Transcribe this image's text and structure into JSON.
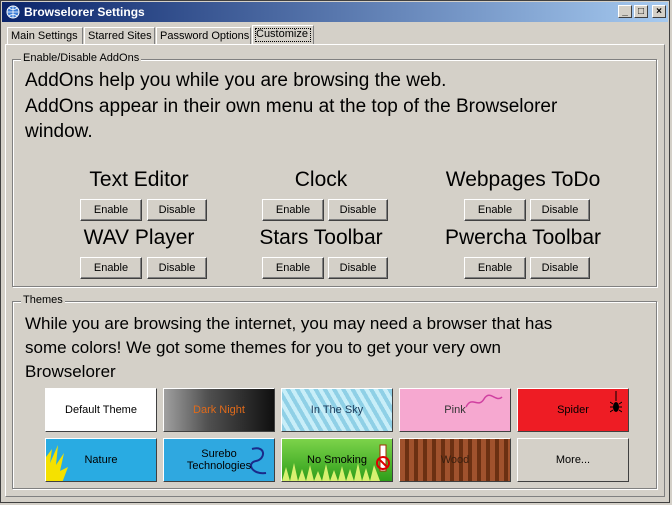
{
  "window": {
    "title": "Browselorer Settings",
    "minimize": "_",
    "maximize": "□",
    "close": "×"
  },
  "tabs": [
    {
      "label": "Main Settings"
    },
    {
      "label": "Starred Sites"
    },
    {
      "label": "Password Options"
    },
    {
      "label": "Customize"
    }
  ],
  "addons": {
    "group_label": "Enable/Disable AddOns",
    "desc_line1": "AddOns help you while you are browsing the web.",
    "desc_line2": "AddOns appear in their own menu at the top of the Browselorer",
    "desc_line3": "window.",
    "enable_label": "Enable",
    "disable_label": "Disable",
    "items": [
      {
        "name": "Text Editor"
      },
      {
        "name": "Clock"
      },
      {
        "name": "Webpages ToDo"
      },
      {
        "name": "WAV Player"
      },
      {
        "name": "Stars Toolbar"
      },
      {
        "name": "Pwercha Toolbar"
      }
    ]
  },
  "themes": {
    "group_label": "Themes",
    "desc_line1": "While you are browsing the internet, you may need a browser that has",
    "desc_line2": "some colors! We got some themes for you to get your very own",
    "desc_line3": "Browselorer",
    "items": [
      {
        "label": "Default Theme",
        "color": "#ffffff"
      },
      {
        "label": "Dark Night",
        "color": "#e06a1a"
      },
      {
        "label": "In The Sky",
        "color": "#1a3a5a"
      },
      {
        "label": "Pink",
        "color": "#333333"
      },
      {
        "label": "Spider",
        "color": "#000000"
      },
      {
        "label": "Nature",
        "color": "#000000"
      },
      {
        "label": "Surebo",
        "label2": "Technologies",
        "color": "#000000"
      },
      {
        "label": "No Smoking",
        "color": "#000000"
      },
      {
        "label": "Wood",
        "color": "#3a2010"
      },
      {
        "label": "More...",
        "color": "#000000"
      }
    ]
  }
}
